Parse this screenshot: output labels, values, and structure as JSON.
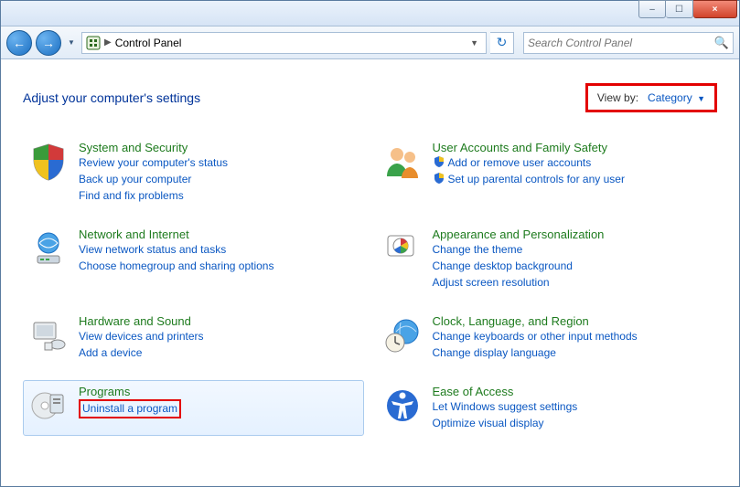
{
  "titlebar": {
    "minimize": "–",
    "maximize": "☐",
    "close": "×"
  },
  "nav": {
    "back_glyph": "←",
    "fwd_glyph": "→",
    "crumb_label": "Control Panel",
    "refresh_glyph": "↻"
  },
  "search": {
    "placeholder": "Search Control Panel"
  },
  "heading": "Adjust your computer's settings",
  "viewby": {
    "label": "View by:",
    "value": "Category"
  },
  "categories": {
    "system": {
      "title": "System and Security",
      "links": [
        "Review your computer's status",
        "Back up your computer",
        "Find and fix problems"
      ]
    },
    "network": {
      "title": "Network and Internet",
      "links": [
        "View network status and tasks",
        "Choose homegroup and sharing options"
      ]
    },
    "hardware": {
      "title": "Hardware and Sound",
      "links": [
        "View devices and printers",
        "Add a device"
      ]
    },
    "programs": {
      "title": "Programs",
      "links": [
        "Uninstall a program"
      ]
    },
    "users": {
      "title": "User Accounts and Family Safety",
      "links": [
        "Add or remove user accounts",
        "Set up parental controls for any user"
      ]
    },
    "appearance": {
      "title": "Appearance and Personalization",
      "links": [
        "Change the theme",
        "Change desktop background",
        "Adjust screen resolution"
      ]
    },
    "clock": {
      "title": "Clock, Language, and Region",
      "links": [
        "Change keyboards or other input methods",
        "Change display language"
      ]
    },
    "ease": {
      "title": "Ease of Access",
      "links": [
        "Let Windows suggest settings",
        "Optimize visual display"
      ]
    }
  }
}
